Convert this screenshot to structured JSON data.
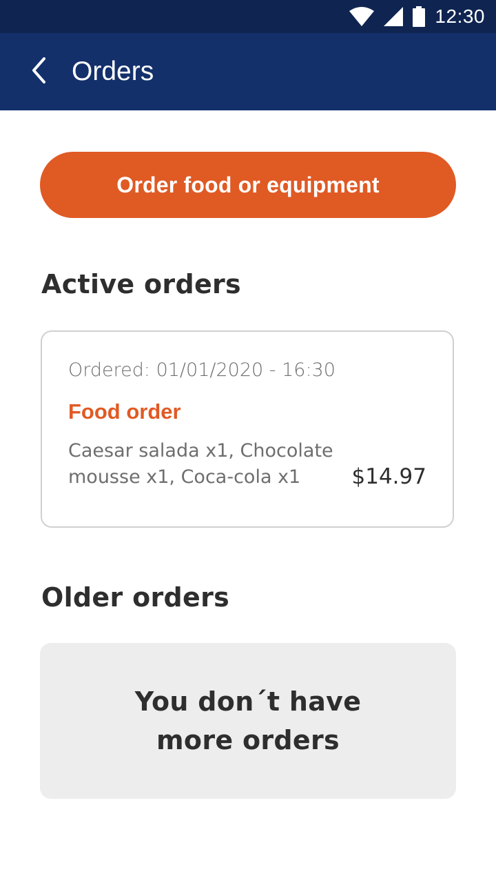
{
  "status_bar": {
    "time": "12:30",
    "icons": [
      "wifi-icon",
      "signal-icon",
      "battery-icon"
    ]
  },
  "app_bar": {
    "title": "Orders",
    "back_icon": "chevron-left-icon"
  },
  "actions": {
    "order_button_label": "Order food or equipment"
  },
  "active_orders": {
    "title": "Active orders",
    "orders": [
      {
        "ordered": "Ordered: 01/01/2020 - 16:30",
        "type": "Food order",
        "items": "Caesar salada x1, Chocolate mousse x1, Coca-cola x1",
        "price": "$14.97"
      }
    ]
  },
  "older_orders": {
    "title": "Older orders",
    "empty_message": "You don´t have more orders"
  },
  "colors": {
    "status_bar": "#0f2450",
    "app_bar": "#13306b",
    "accent": "#e05a24",
    "text_primary": "#2e2e2e",
    "text_secondary": "#6e6e6e",
    "empty_bg": "#ededed"
  }
}
